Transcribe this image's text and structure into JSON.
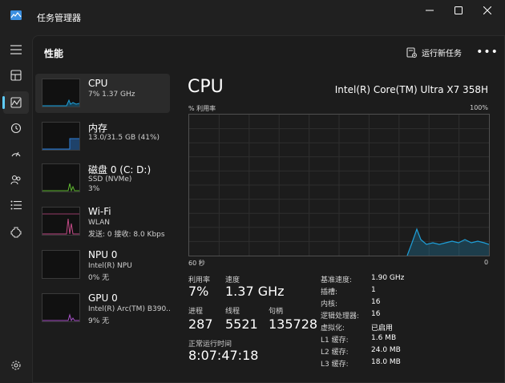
{
  "window": {
    "title": "任务管理器",
    "icon": "task-manager-icon"
  },
  "colors": {
    "accent": "#60cdff",
    "cpu_graph": "#1e9fd8",
    "memory_graph": "#2f7fd6",
    "disk_graph": "#5fb830",
    "wifi_graph": "#c24a86",
    "gpu_graph": "#a750c8"
  },
  "nav": {
    "items": [
      {
        "icon": "hamburger-menu-icon"
      },
      {
        "icon": "processes-icon"
      },
      {
        "icon": "performance-icon"
      },
      {
        "icon": "app-history-icon"
      },
      {
        "icon": "startup-apps-icon"
      },
      {
        "icon": "users-icon"
      },
      {
        "icon": "details-icon"
      },
      {
        "icon": "services-icon"
      },
      {
        "icon": "settings-icon"
      }
    ]
  },
  "header": {
    "title": "性能",
    "run_task_label": "运行新任务",
    "more_label": "•••"
  },
  "devices": [
    {
      "name": "CPU",
      "line1": "7% 1.37 GHz",
      "line2": ""
    },
    {
      "name": "内存",
      "line1": "13.0/31.5 GB (41%)",
      "line2": ""
    },
    {
      "name": "磁盘 0 (C: D:)",
      "line1": "SSD (NVMe)",
      "line2": "3%"
    },
    {
      "name": "Wi-Fi",
      "line1": "WLAN",
      "line2": "发送: 0 接收: 8.0 Kbps"
    },
    {
      "name": "NPU 0",
      "line1": "Intel(R) NPU",
      "line2": "0% 无"
    },
    {
      "name": "GPU 0",
      "line1": "Intel(R) Arc(TM) B390...",
      "line2": "9% 无"
    }
  ],
  "detail": {
    "title": "CPU",
    "model": "Intel(R) Core(TM) Ultra X7 358H",
    "graph_label_left": "% 利用率",
    "graph_label_right": "100%",
    "axis_left": "60 秒",
    "axis_right": "0",
    "stats": {
      "utilization_label": "利用率",
      "utilization_value": "7%",
      "speed_label": "速度",
      "speed_value": "1.37 GHz",
      "processes_label": "进程",
      "processes_value": "287",
      "threads_label": "线程",
      "threads_value": "5521",
      "handles_label": "句柄",
      "handles_value": "135728",
      "uptime_label": "正常运行时间",
      "uptime_value": "8:07:47:18"
    },
    "specs": [
      {
        "key": "基准速度:",
        "value": "1.90 GHz"
      },
      {
        "key": "插槽:",
        "value": "1"
      },
      {
        "key": "内核:",
        "value": "16"
      },
      {
        "key": "逻辑处理器:",
        "value": "16"
      },
      {
        "key": "虚拟化:",
        "value": "已启用"
      },
      {
        "key": "L1 缓存:",
        "value": "1.6 MB"
      },
      {
        "key": "L2 缓存:",
        "value": "24.0 MB"
      },
      {
        "key": "L3 缓存:",
        "value": "18.0 MB"
      }
    ]
  }
}
